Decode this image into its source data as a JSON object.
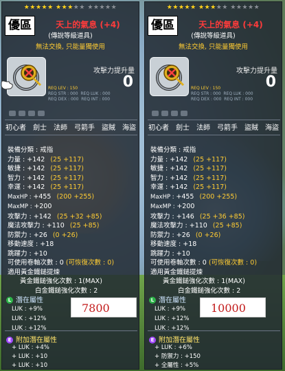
{
  "tooltips": [
    {
      "stars_on": 8,
      "stars_off": 7,
      "legend_badge": "優區",
      "item_name": "天上的氣息 (+4)",
      "grade": "(傳說等級道具)",
      "trade": "無法交換, 只能量獨使用",
      "req": {
        "lev": "REQ LEV : 150",
        "str": "REQ STR : 000",
        "dex": "REQ DEX : 000",
        "luk": "REQ LUK : 000",
        "int": "REQ INT : 000"
      },
      "atk_label": "攻擊力提升量",
      "atk_value": "0",
      "jobs": [
        "初心者",
        "劍士",
        "法師",
        "弓箭手",
        "盜賊",
        "海盜"
      ],
      "category": "裝備分類 : 戒指",
      "stats": [
        {
          "label": "力量 : ",
          "value": "+142",
          "detail": "(25 +117)"
        },
        {
          "label": "敏捷 : ",
          "value": "+142",
          "detail": "(25 +117)"
        },
        {
          "label": "智力 : ",
          "value": "+142",
          "detail": "(25 +117)"
        },
        {
          "label": "幸運 : ",
          "value": "+142",
          "detail": "(25 +117)"
        },
        {
          "label": "MaxHP : ",
          "value": "+455",
          "detail": "(200 +255)"
        },
        {
          "label": "MaxMP : ",
          "value": "+200",
          "detail": ""
        },
        {
          "label": "攻擊力 : ",
          "value": "+142",
          "detail": "(25 +32 +85)"
        },
        {
          "label": "魔法攻擊力 : ",
          "value": "+110",
          "detail": "(25 +85)"
        },
        {
          "label": "防禦力 : ",
          "value": "+26",
          "detail": "(0 +26)"
        },
        {
          "label": "移動速度 : ",
          "value": "+18",
          "detail": ""
        },
        {
          "label": "跳躍力 : ",
          "value": "+10",
          "detail": ""
        }
      ],
      "upgrades": "可使用卷軸次數 : 0",
      "restores": "(可恢復次數 : 0)",
      "hammer_applied": "適用黃金鐵鎚提煉",
      "hammer_count": "黃金鐵鎚強化次數 : 1(MAX)",
      "white_hammer": "白金鐵鎚強化次數 : 2",
      "potential_title": "潛在屬性",
      "potential_lines": [
        "LUK : +9%",
        "LUK : +12%",
        "LUK : +12%"
      ],
      "additional_title": "附加潛在屬性",
      "additional_lines": [
        "+ LUK : +4%",
        "+ LUK : +10",
        "+ LUK : +10"
      ],
      "note": "7800"
    },
    {
      "stars_on": 8,
      "stars_off": 7,
      "legend_badge": "優區",
      "item_name": "天上的氣息 (+4)",
      "grade": "(傳說等級道具)",
      "trade": "無法交換, 只能量獨使用",
      "req": {
        "lev": "REQ LEV : 150",
        "str": "REQ STR : 000",
        "dex": "REQ DEX : 000",
        "luk": "REQ LUK : 000",
        "int": "REQ INT : 000"
      },
      "atk_label": "攻擊力提升量",
      "atk_value": "0",
      "jobs": [
        "初心者",
        "劍士",
        "法師",
        "弓箭手",
        "盜賊",
        "海盜"
      ],
      "category": "裝備分類 : 戒指",
      "stats": [
        {
          "label": "力量 : ",
          "value": "+142",
          "detail": "(25 +117)"
        },
        {
          "label": "敏捷 : ",
          "value": "+142",
          "detail": "(25 +117)"
        },
        {
          "label": "智力 : ",
          "value": "+142",
          "detail": "(25 +117)"
        },
        {
          "label": "幸運 : ",
          "value": "+142",
          "detail": "(25 +117)"
        },
        {
          "label": "MaxHP : ",
          "value": "+455",
          "detail": "(200 +255)"
        },
        {
          "label": "MaxMP : ",
          "value": "+200",
          "detail": ""
        },
        {
          "label": "攻擊力 : ",
          "value": "+146",
          "detail": "(25 +36 +85)"
        },
        {
          "label": "魔法攻擊力 : ",
          "value": "+110",
          "detail": "(25 +85)"
        },
        {
          "label": "防禦力 : ",
          "value": "+26",
          "detail": "(0 +26)"
        },
        {
          "label": "移動速度 : ",
          "value": "+18",
          "detail": ""
        },
        {
          "label": "跳躍力 : ",
          "value": "+10",
          "detail": ""
        }
      ],
      "upgrades": "可使用卷軸次數 : 0",
      "restores": "(可恢復次數 : 0)",
      "hammer_applied": "適用黃金鐵鎚提煉",
      "hammer_count": "黃金鐵鎚強化次數 : 1(MAX)",
      "white_hammer": "白金鐵鎚強化次數 : 2",
      "potential_title": "潛在屬性",
      "potential_lines": [
        "LUK : +9%",
        "LUK : +12%",
        "LUK : +12%"
      ],
      "additional_title": "附加潛在屬性",
      "additional_lines": [
        "+ LUK : +6%",
        "+ 防禦力 : +150",
        "+ 全屬性 : +5%"
      ],
      "note": "10000"
    }
  ],
  "colors": {
    "item_name": "#ff3b3b",
    "trade": "#ffcc33",
    "star_on": "#ffd21a",
    "bonus": "#ffcc33",
    "note_text": "#c21a1a"
  }
}
